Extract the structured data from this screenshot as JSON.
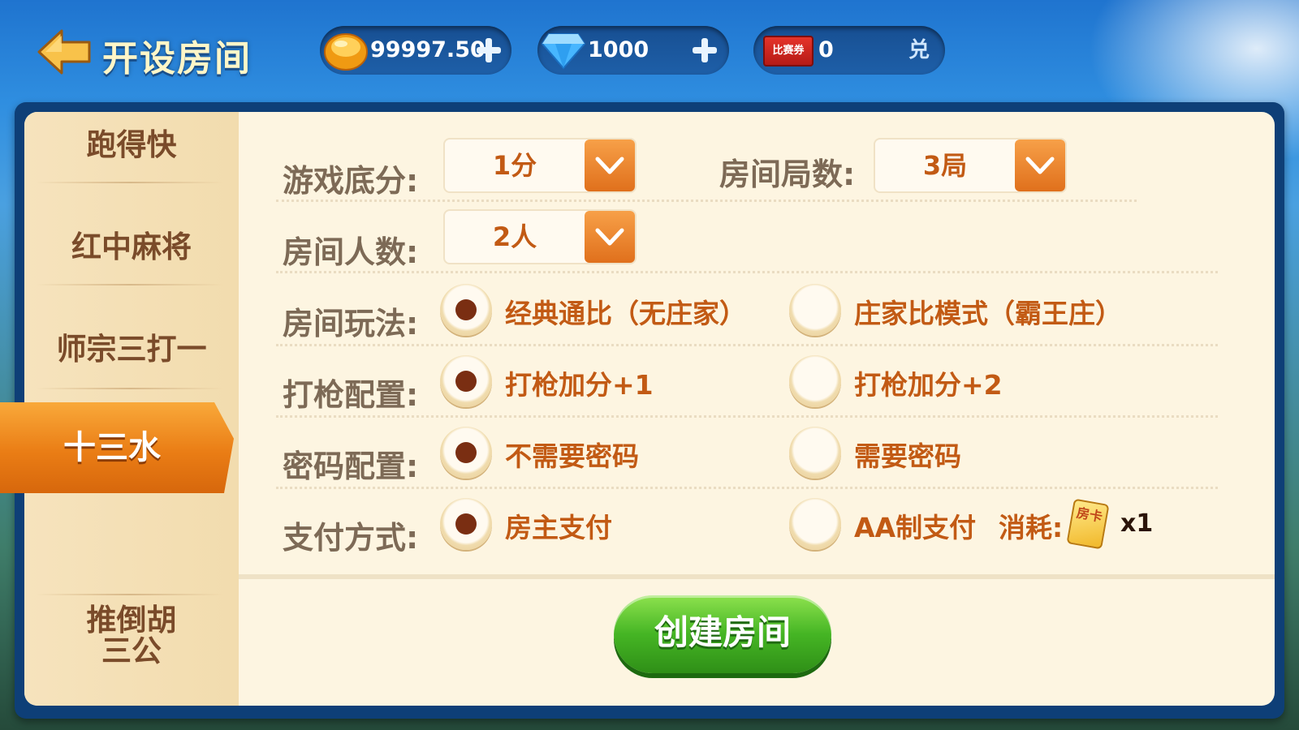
{
  "header": {
    "title": "开设房间",
    "gold": "99997.50",
    "diamonds": "1000",
    "tickets": "0",
    "ticket_icon_text": "比赛券",
    "exchange_label": "兑"
  },
  "sidebar": {
    "items": [
      "跑得快",
      "红中麻将",
      "师宗三打一",
      "十三水",
      "推倒胡",
      "三公"
    ],
    "active": "十三水"
  },
  "form": {
    "base_score": {
      "label": "游戏底分:",
      "value": "1分"
    },
    "rounds": {
      "label": "房间局数:",
      "value": "3局"
    },
    "players": {
      "label": "房间人数:",
      "value": "2人"
    },
    "mode": {
      "label": "房间玩法:",
      "options": [
        "经典通比（无庄家）",
        "庄家比模式（霸王庄）"
      ],
      "selected": 0
    },
    "shoot": {
      "label": "打枪配置:",
      "options": [
        "打枪加分+1",
        "打枪加分+2"
      ],
      "selected": 0
    },
    "password": {
      "label": "密码配置:",
      "options": [
        "不需要密码",
        "需要密码"
      ],
      "selected": 0
    },
    "payment": {
      "label": "支付方式:",
      "options": [
        "房主支付",
        "AA制支付"
      ],
      "selected": 0
    },
    "cost_label": "消耗:",
    "card_icon_text": "房卡",
    "cost_count": "x1"
  },
  "actions": {
    "create_label": "创建房间"
  },
  "colors": {
    "accent_orange": "#e0701c",
    "text_brown": "#7d6a56",
    "option_orange": "#c25a14",
    "create_green": "#45b524",
    "frame_blue": "#0e3f77"
  }
}
